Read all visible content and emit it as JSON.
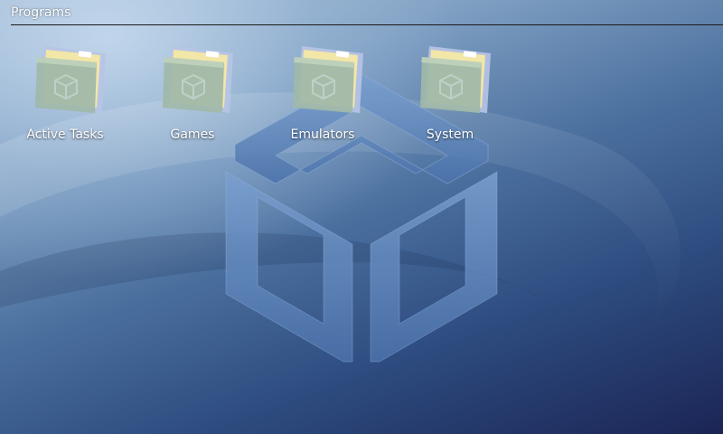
{
  "header": {
    "title": "Programs"
  },
  "icons": [
    {
      "label": "Active Tasks",
      "icon": "folder-icon"
    },
    {
      "label": "Games",
      "icon": "folder-icon"
    },
    {
      "label": "Emulators",
      "icon": "folder-icon"
    },
    {
      "label": "System",
      "icon": "folder-icon"
    }
  ],
  "colors": {
    "background_top": "#a9bfd6",
    "background_bottom": "#1b2555",
    "logo": "#5e86bf",
    "folder_front": "#9fb8a8",
    "folder_paper": "#f2e6a8",
    "text": "#ffffff"
  }
}
